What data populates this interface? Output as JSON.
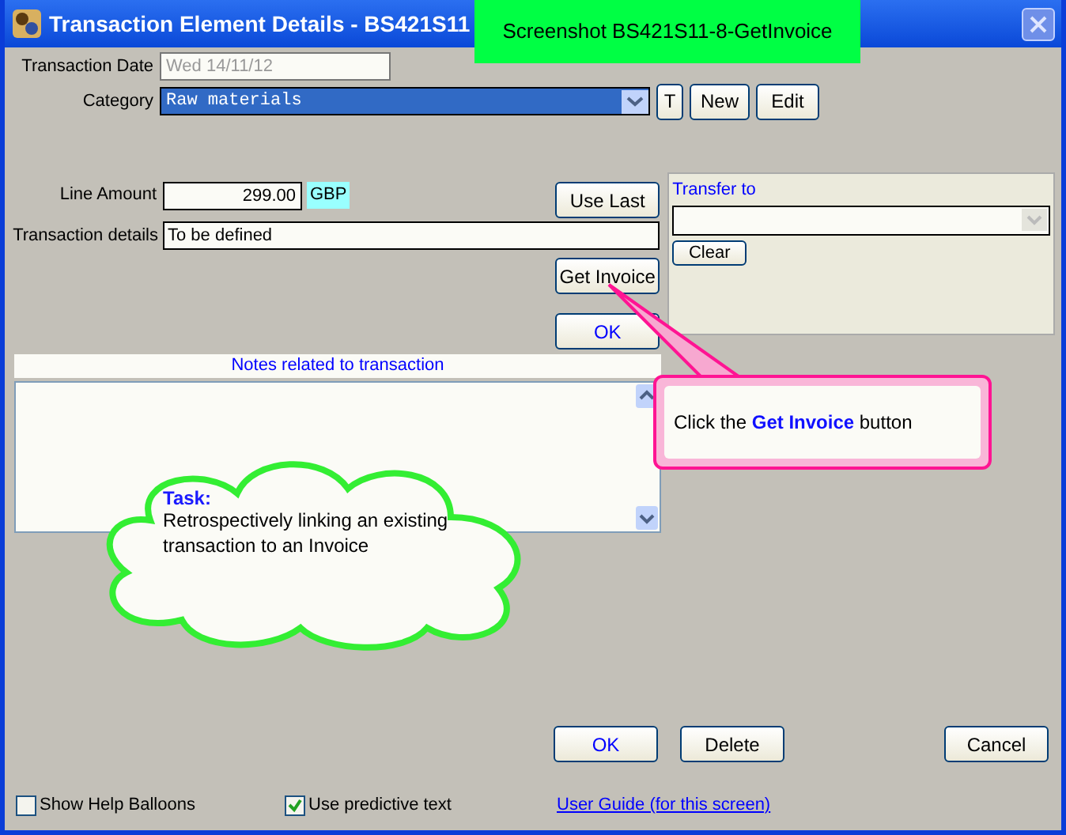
{
  "window": {
    "title": "Transaction Element Details - BS421S11"
  },
  "banner": "Screenshot BS421S11-8-GetInvoice",
  "transaction_date": {
    "label": "Transaction Date",
    "value": "Wed 14/11/12",
    "disabled": true
  },
  "category": {
    "label": "Category",
    "value": "Raw materials",
    "buttons": [
      "T",
      "New",
      "Edit"
    ]
  },
  "line_amount": {
    "label": "Line Amount",
    "value": "299.00",
    "currency": "GBP"
  },
  "transaction_details": {
    "label": "Transaction details",
    "value": "To be defined"
  },
  "side_buttons": [
    "Use Last",
    "Get Invoice",
    "OK"
  ],
  "transfer": {
    "title": "Transfer to",
    "button": "Clear"
  },
  "notes": {
    "title": "Notes related to transaction"
  },
  "callout": "Click the **Get Invoice** button",
  "task": {
    "title": "Task:",
    "text": "Retrospectively linking an existing transaction to an Invoice"
  },
  "bottom_buttons": [
    {
      "label": "OK",
      "kind": "primary"
    },
    {
      "label": "Delete",
      "kind": "normal"
    },
    {
      "label": "Cancel",
      "kind": "normal"
    }
  ],
  "checkboxes": [
    {
      "label": "Show Help Balloons",
      "checked": false
    },
    {
      "label": "Use predictive text",
      "checked": true
    }
  ],
  "link": "User Guide (for this screen)"
}
